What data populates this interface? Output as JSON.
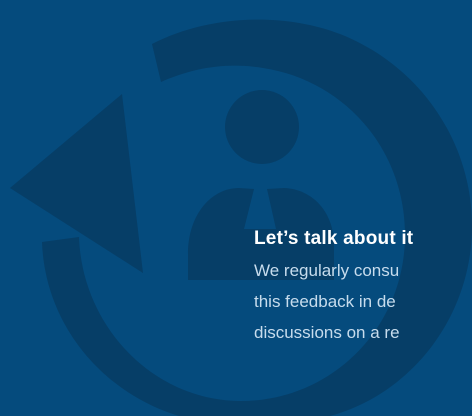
{
  "colors": {
    "background": "#054b7d",
    "graphic": "#063e67",
    "title": "#ffffff",
    "body_text": "#c7dced"
  },
  "graphic": {
    "icon": "feedback-cycle-person-icon"
  },
  "content": {
    "title": "Let’s talk about it",
    "body_lines": [
      "We regularly consu",
      "this feedback in de",
      "discussions on a re"
    ]
  }
}
